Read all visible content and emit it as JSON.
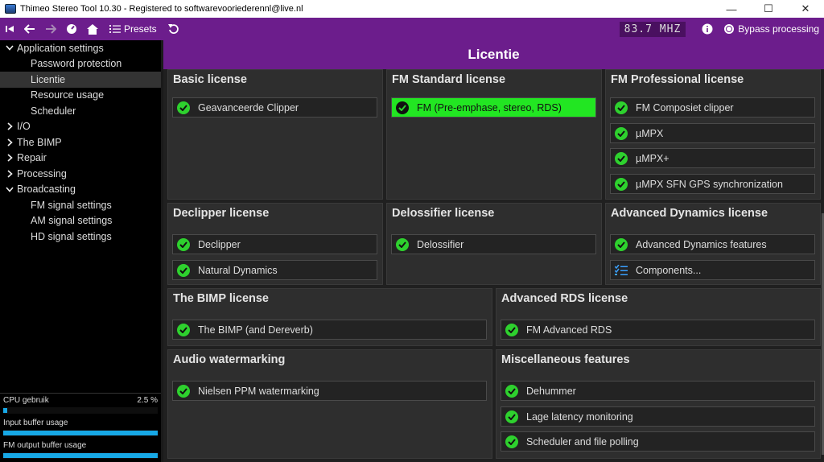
{
  "window": {
    "title": "Thimeo Stereo Tool 10.30 - Registered to softwarevooriederennl@live.nl",
    "min": "—",
    "max": "☐",
    "close": "✕"
  },
  "toolbar": {
    "presets_label": "Presets",
    "frequency": "83.7 MHZ",
    "bypass_label": "Bypass processing"
  },
  "sidebar": {
    "items": [
      {
        "label": "Application settings",
        "level": 0,
        "expanded": true
      },
      {
        "label": "Password protection",
        "level": 1
      },
      {
        "label": "Licentie",
        "level": 1,
        "selected": true
      },
      {
        "label": "Resource usage",
        "level": 1
      },
      {
        "label": "Scheduler",
        "level": 1
      },
      {
        "label": "I/O",
        "level": 0,
        "expanded": false
      },
      {
        "label": "The BIMP",
        "level": 0,
        "expanded": false
      },
      {
        "label": "Repair",
        "level": 0,
        "expanded": false
      },
      {
        "label": "Processing",
        "level": 0,
        "expanded": false
      },
      {
        "label": "Broadcasting",
        "level": 0,
        "expanded": true
      },
      {
        "label": "FM signal settings",
        "level": 1
      },
      {
        "label": "AM signal settings",
        "level": 1
      },
      {
        "label": "HD signal settings",
        "level": 1
      }
    ],
    "stats": {
      "cpu_label": "CPU gebruik",
      "cpu_value": "2.5 %",
      "cpu_fraction": 0.025,
      "input_label": "Input buffer usage",
      "input_fraction": 1.0,
      "output_label": "FM output buffer usage",
      "output_fraction": 1.0
    }
  },
  "main": {
    "title": "Licentie",
    "panels": {
      "basic": {
        "title": "Basic license",
        "features": [
          "Geavanceerde Clipper"
        ]
      },
      "fm_standard": {
        "title": "FM Standard license",
        "features": [
          "FM (Pre-emphase, stereo, RDS)"
        ]
      },
      "fm_professional": {
        "title": "FM Professional license",
        "features": [
          "FM Composiet clipper",
          "µMPX",
          "µMPX+",
          "µMPX SFN GPS synchronization"
        ]
      },
      "declipper": {
        "title": "Declipper license",
        "features": [
          "Declipper",
          "Natural Dynamics"
        ]
      },
      "delossifier": {
        "title": "Delossifier license",
        "features": [
          "Delossifier"
        ]
      },
      "advanced_dynamics": {
        "title": "Advanced Dynamics license",
        "features": [
          "Advanced Dynamics features",
          "Components..."
        ]
      },
      "bimp": {
        "title": "The BIMP license",
        "features": [
          "The BIMP (and Dereverb)"
        ]
      },
      "advanced_rds": {
        "title": "Advanced RDS license",
        "features": [
          "FM Advanced RDS"
        ]
      },
      "watermarking": {
        "title": "Audio watermarking",
        "features": [
          "Nielsen PPM watermarking"
        ]
      },
      "misc": {
        "title": "Miscellaneous features",
        "features": [
          "Dehummer",
          "Lage latency monitoring",
          "Scheduler and file polling"
        ]
      }
    }
  },
  "colors": {
    "accent": "#6c1d8c",
    "check_green": "#2ed12e",
    "active_green": "#22e622",
    "meter_blue": "#17a8e6"
  }
}
